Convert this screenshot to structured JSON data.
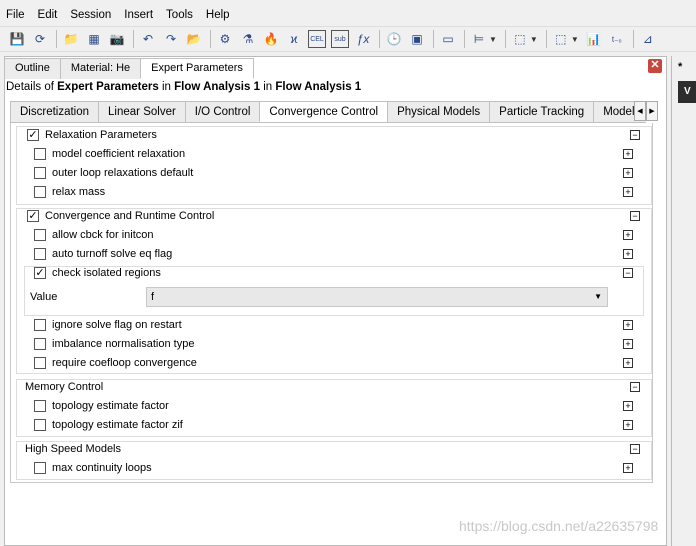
{
  "menu": [
    "File",
    "Edit",
    "Session",
    "Insert",
    "Tools",
    "Help"
  ],
  "toolbar": {
    "icons": [
      "save-icon",
      "refresh-icon",
      "folder-icon",
      "network-icon",
      "camera-icon",
      "undo-icon",
      "redo-icon",
      "open-icon",
      "mesh-icon",
      "flask-icon",
      "flame-icon",
      "variable-icon",
      "cel-icon",
      "sub-icon",
      "fx-icon",
      "clock-icon",
      "view-icon",
      "box-icon",
      "tree-icon",
      "solid-icon",
      "solid2-icon",
      "chart-icon",
      "time-icon"
    ],
    "glyphs": [
      "💾",
      "⟳",
      "📁",
      "▦",
      "📷",
      "↶",
      "↷",
      "📂",
      "⚙",
      "⚗",
      "🔥",
      "ϰ",
      "CEL",
      "sub",
      "ƒx",
      "🕒",
      "▣",
      "▭",
      "⊨",
      "⬚",
      "⬚",
      "📊",
      "t₋₀",
      "⊿"
    ]
  },
  "top_tabs": [
    "Outline",
    "Material: He",
    "Expert Parameters"
  ],
  "close_glyph": "✕",
  "details": {
    "prefix": "Details of ",
    "object": "Expert Parameters",
    "mid": " in ",
    "target": "Flow Analysis 1",
    "mid2": " in ",
    "target2": "Flow Analysis 1"
  },
  "sub_tabs": [
    "Discretization",
    "Linear Solver",
    "I/O Control",
    "Convergence Control",
    "Physical Models",
    "Particle Tracking",
    "Model O"
  ],
  "active_sub_tab": "Convergence Control",
  "groups": [
    {
      "label": "Relaxation Parameters",
      "checked": true,
      "items": [
        {
          "label": "model coefficient relaxation",
          "checked": false
        },
        {
          "label": "outer loop relaxations default",
          "checked": false
        },
        {
          "label": "relax mass",
          "checked": false
        }
      ]
    },
    {
      "label": "Convergence and Runtime Control",
      "checked": true,
      "items": [
        {
          "label": "allow cbck for initcon",
          "checked": false
        },
        {
          "label": "auto turnoff solve eq flag",
          "checked": false
        },
        {
          "label": "check isolated regions",
          "checked": true
        },
        {
          "label": "ignore solve flag on restart",
          "checked": false
        },
        {
          "label": "imbalance normalisation type",
          "checked": false
        },
        {
          "label": "require coefloop convergence",
          "checked": false
        }
      ]
    },
    {
      "label": "Memory Control",
      "items": [
        {
          "label": "topology estimate factor",
          "checked": false
        },
        {
          "label": "topology estimate factor zif",
          "checked": false
        }
      ]
    },
    {
      "label": "High Speed Models",
      "items": [
        {
          "label": "max continuity loops",
          "checked": false
        }
      ]
    }
  ],
  "value_field": {
    "label": "Value",
    "value": "f"
  },
  "right_strip": {
    "tab": "*",
    "bar": "V"
  },
  "watermark": "https://blog.csdn.net/a22635798"
}
